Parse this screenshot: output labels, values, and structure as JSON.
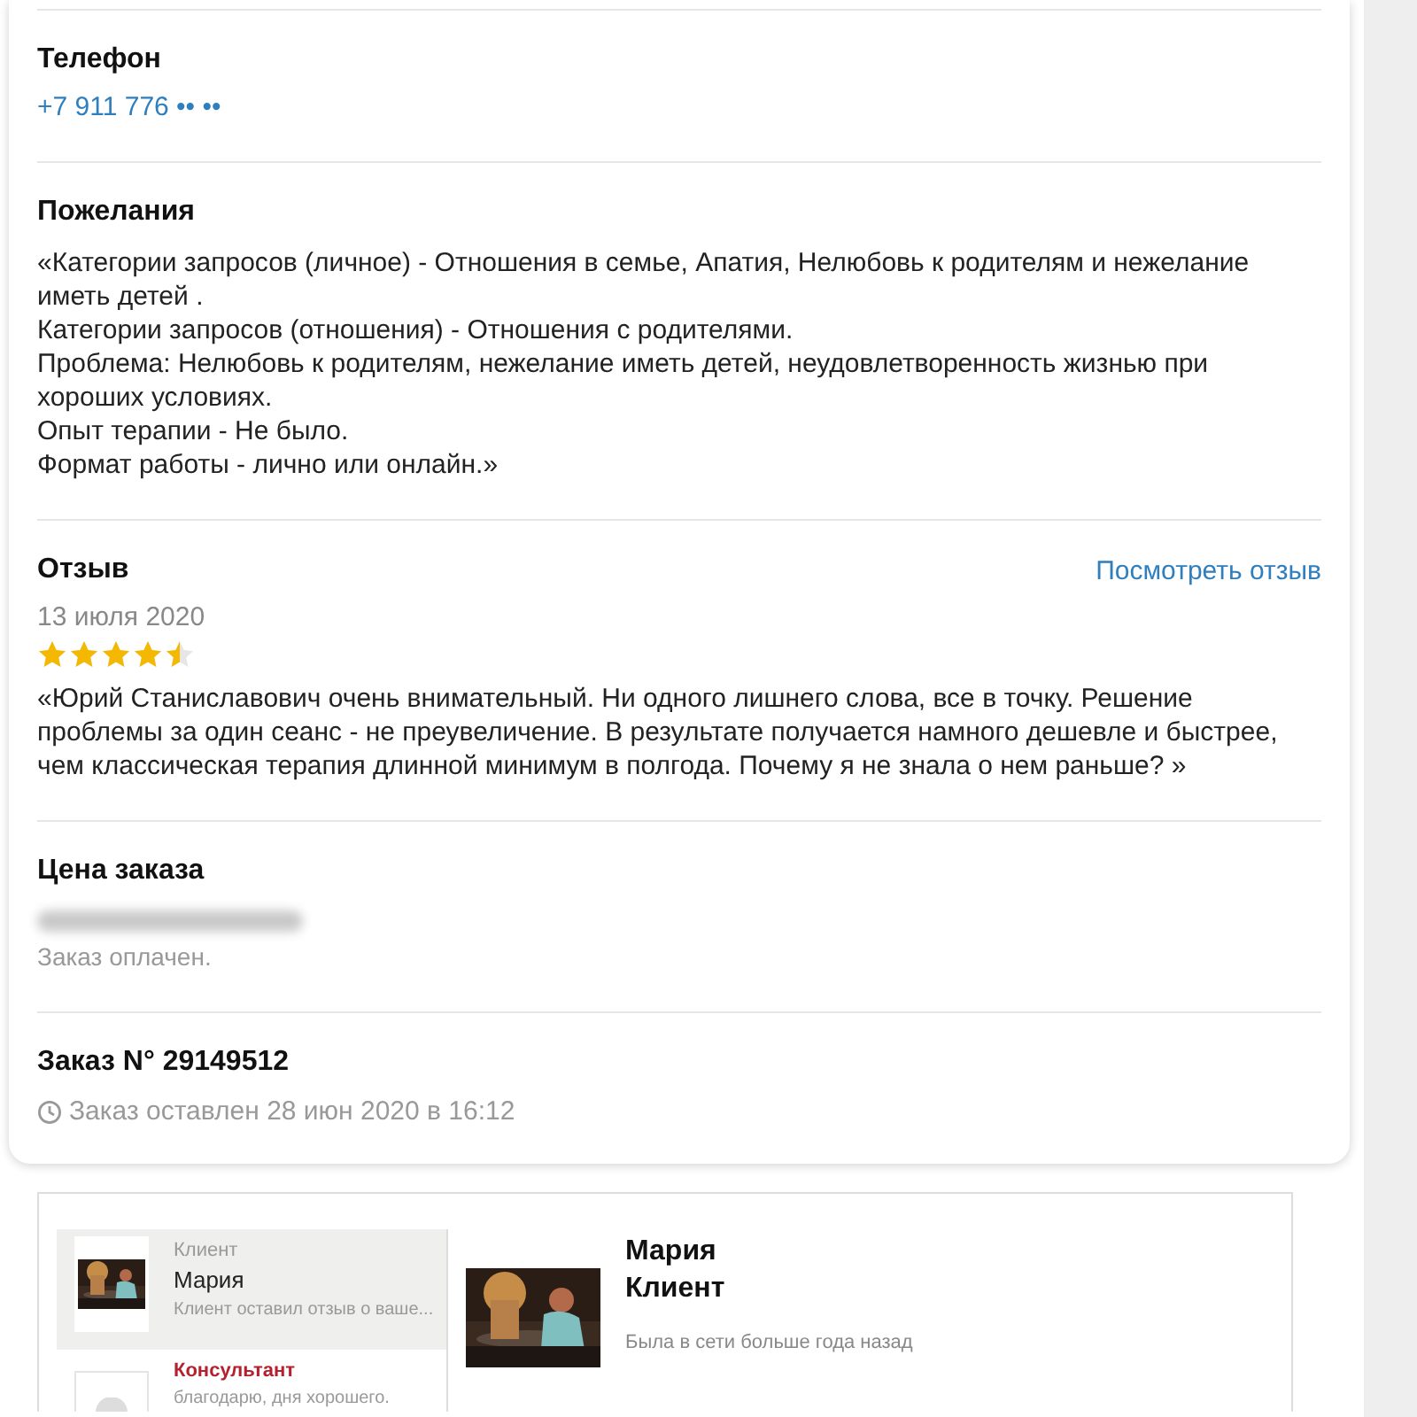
{
  "phone": {
    "title": "Телефон",
    "value": "+7 911 776 •• ••"
  },
  "wishes": {
    "title": "Пожелания",
    "lines": [
      "«Категории запросов (личное) - Отношения в семье, Апатия, Нелюбовь к родителям и нежелание иметь детей .",
      "Категории запросов (отношения) - Отношения с родителями.",
      "Проблема: Нелюбовь к родителям, нежелание иметь детей, неудовлетворенность жизнью при хороших условиях.",
      "Опыт терапии - Не было.",
      "Формат работы - лично или онлайн.»"
    ]
  },
  "review": {
    "title": "Отзыв",
    "link": "Посмотреть отзыв",
    "date": "13 июля 2020",
    "stars": 4.5,
    "text": "«Юрий Станиславович очень внимательный. Ни одного лишнего слова, все в точку. Решение проблемы за один сеанс - не преувеличение. В результате получается намного дешевле и быстрее, чем классическая терапия длинной минимум в полгода. Почему я не знала о нем раньше? »"
  },
  "price": {
    "title": "Цена заказа",
    "redacted": true,
    "status": "Заказ оплачен."
  },
  "order": {
    "title": "Заказ N° 29149512",
    "placed": "Заказ оставлен 28 июн 2020 в 16:12"
  },
  "chat": {
    "dialogs": [
      {
        "kind": "client",
        "role": "Клиент",
        "name": "Мария",
        "preview": "Клиент оставил отзыв о ваше...",
        "selected": true
      },
      {
        "kind": "consultant",
        "role": "Консультант",
        "preview": "благодарю, дня хорошего.",
        "selected": false
      }
    ],
    "contact": {
      "name": "Мария",
      "role": "Клиент",
      "status": "Была в сети больше года назад"
    }
  }
}
